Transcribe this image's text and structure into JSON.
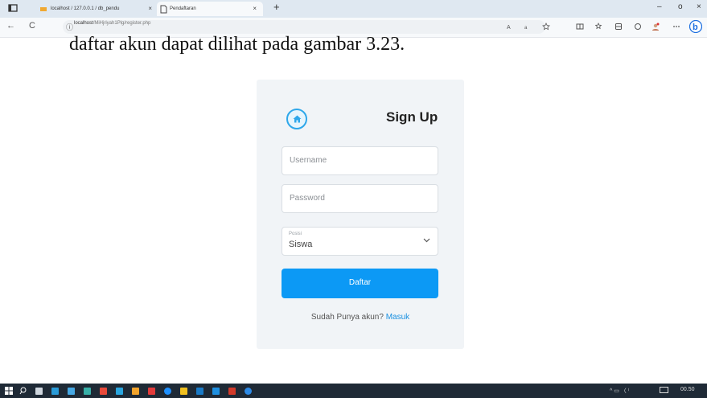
{
  "browser": {
    "tabs": [
      {
        "label": "localhost / 127.0.0.1 / db_pendu",
        "close": "×"
      },
      {
        "label": "Pendaftaran",
        "close": "×"
      }
    ],
    "new_tab": "+",
    "window_controls": [
      "–",
      "o",
      "×"
    ],
    "nav": {
      "back": "←",
      "reload": "C",
      "info": "ⓘ"
    },
    "url": {
      "host": "localhost",
      "path": "/MiHjriyah1Plg/register.php"
    },
    "toolbar_icons": [
      "read-aloud-icon",
      "translate-icon",
      "favorite-icon",
      "split-screen-icon",
      "favorites-icon",
      "collections-icon",
      "extensions-icon",
      "profile-icon",
      "more-icon",
      "bing-icon"
    ]
  },
  "caption": "daftar akun dapat dilihat pada gambar 3.23.",
  "form": {
    "title": "Sign Up",
    "username_placeholder": "Username",
    "password_placeholder": "Password",
    "posisi_label": "Posisi",
    "posisi_value": "Siswa",
    "submit_label": "Daftar",
    "login_prompt": "Sudah Punya akun?",
    "login_link": "Masuk"
  },
  "taskbar": {
    "clock": "00.50",
    "tray": "^ ▭ 〈 ⁽"
  },
  "colors": {
    "accent": "#0c99f5",
    "card_bg": "#f1f4f7",
    "taskbar": "#1f2a36"
  }
}
